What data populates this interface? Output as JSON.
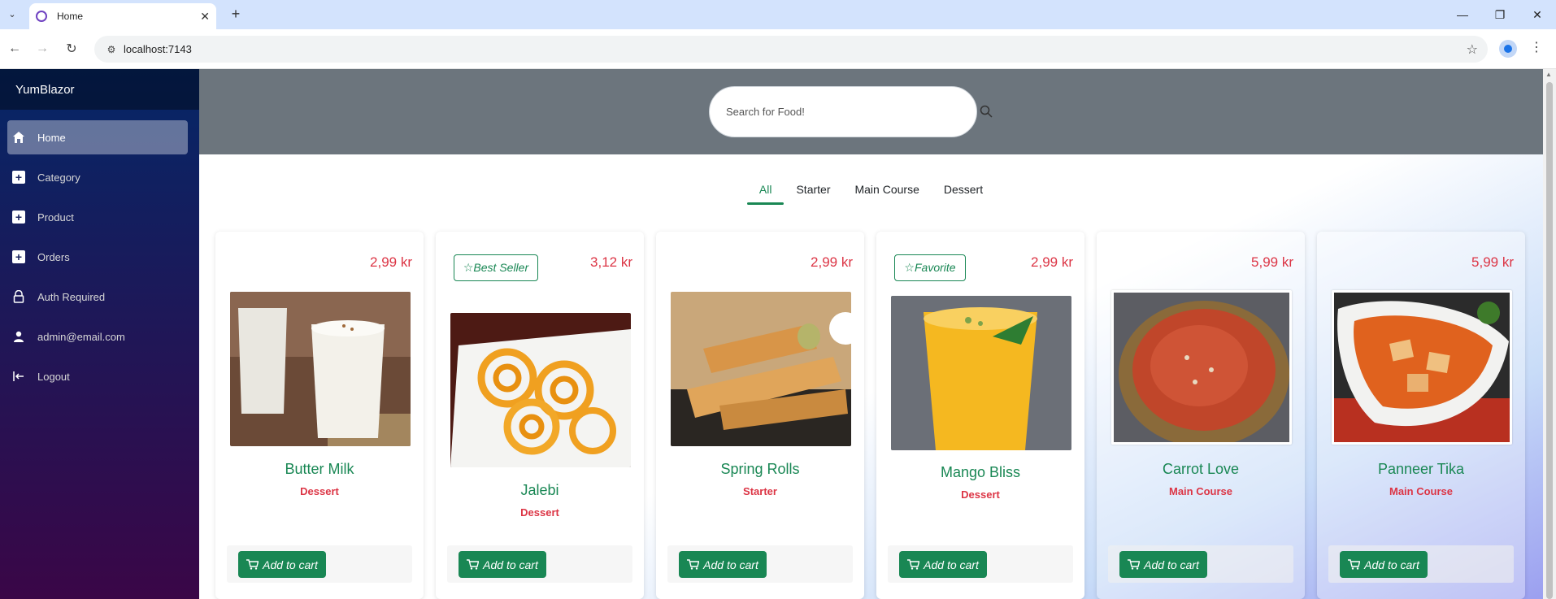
{
  "browser": {
    "tab_title": "Home",
    "url": "localhost:7143",
    "new_tab_symbol": "+",
    "tab_close_symbol": "✕"
  },
  "sidebar": {
    "brand": "YumBlazor",
    "items": [
      {
        "label": "Home",
        "icon": "home-icon"
      },
      {
        "label": "Category",
        "icon": "plus-square-icon"
      },
      {
        "label": "Product",
        "icon": "plus-square-icon"
      },
      {
        "label": "Orders",
        "icon": "plus-square-icon"
      },
      {
        "label": "Auth Required",
        "icon": "lock-icon"
      },
      {
        "label": "admin@email.com",
        "icon": "person-icon"
      },
      {
        "label": "Logout",
        "icon": "logout-icon"
      }
    ]
  },
  "search": {
    "placeholder": "Search for Food!"
  },
  "category_tabs": [
    "All",
    "Starter",
    "Main Course",
    "Dessert"
  ],
  "products": [
    {
      "name": "Butter Milk",
      "category": "Dessert",
      "price": "2,99 kr",
      "badge": ""
    },
    {
      "name": "Jalebi",
      "category": "Dessert",
      "price": "3,12 kr",
      "badge": "Best Seller"
    },
    {
      "name": "Spring Rolls",
      "category": "Starter",
      "price": "2,99 kr",
      "badge": ""
    },
    {
      "name": "Mango Bliss",
      "category": "Dessert",
      "price": "2,99 kr",
      "badge": "Favorite"
    },
    {
      "name": "Carrot Love",
      "category": "Main Course",
      "price": "5,99 kr",
      "badge": ""
    },
    {
      "name": "Panneer Tika",
      "category": "Main Course",
      "price": "5,99 kr",
      "badge": ""
    }
  ],
  "cart_button_label": "Add to cart",
  "colors": {
    "accent": "#198754",
    "price": "#dc3545",
    "search_band": "#6c757d",
    "sidebar_top": "#052767",
    "sidebar_bottom": "#3a0647"
  }
}
